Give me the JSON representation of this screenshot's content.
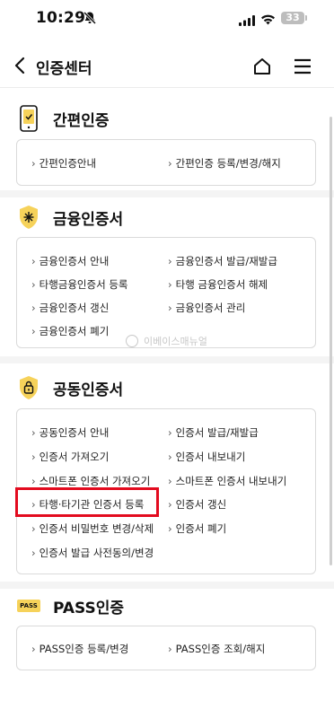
{
  "status_bar": {
    "time": "10:29",
    "battery": "33"
  },
  "header": {
    "title": "인증센터"
  },
  "watermark": "이베이스매뉴얼",
  "sections": {
    "simple": {
      "title": "간편인증",
      "items": [
        "간편인증안내",
        "간편인증 등록/변경/해지"
      ]
    },
    "financial": {
      "title": "금융인증서",
      "items": [
        "금융인증서 안내",
        "금융인증서 발급/재발급",
        "타행금융인증서 등록",
        "타행 금융인증서 해제",
        "금융인증서 갱신",
        "금융인증서 관리",
        "금융인증서 폐기"
      ]
    },
    "joint": {
      "title": "공동인증서",
      "items": [
        "공동인증서 안내",
        "인증서 발급/재발급",
        "인증서 가져오기",
        "인증서 내보내기",
        "스마트폰 인증서 가져오기",
        "스마트폰 인증서 내보내기",
        "타행·타기관 인증서 등록",
        "인증서 갱신",
        "인증서 비밀번호 변경/삭제",
        "인증서 폐기",
        "인증서 발급 사전동의/변경"
      ]
    },
    "pass": {
      "title": "PASS인증",
      "icon_text": "PASS",
      "items": [
        "PASS인증 등록/변경",
        "PASS인증 조회/해지"
      ]
    }
  },
  "colors": {
    "accent_yellow": "#f6d25a",
    "highlight_red": "#e30b1f"
  }
}
